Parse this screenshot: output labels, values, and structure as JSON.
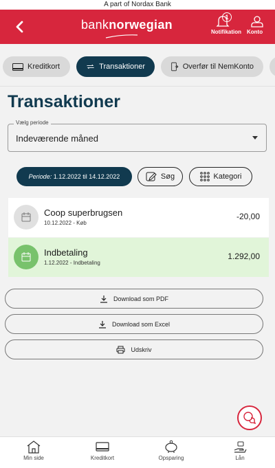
{
  "topbar": {
    "text": "A part of Nordax Bank"
  },
  "header": {
    "logo_light": "bank",
    "logo_bold": "norwegian",
    "notification_label": "Notifikation",
    "notification_count": "1",
    "account_label": "Konto",
    "brand_color": "#d7263d"
  },
  "tabs": [
    {
      "label": "Kreditkort",
      "icon": "credit-card-icon",
      "active": false
    },
    {
      "label": "Transaktioner",
      "icon": "transfer-arrows-icon",
      "active": true
    },
    {
      "label": "Overfør til NemKonto",
      "icon": "transfer-phone-icon",
      "active": false
    }
  ],
  "page": {
    "title": "Transaktioner"
  },
  "period_select": {
    "legend": "Vælg periode",
    "value": "Indeværende måned"
  },
  "filters": {
    "period_prefix": "Periode:",
    "period_range": "1.12.2022 til 14.12.2022",
    "search_label": "Søg",
    "category_label": "Kategori"
  },
  "transactions": [
    {
      "name": "Coop superbrugsen",
      "date": "10.12.2022",
      "type": "Køb",
      "amount": "-20,00"
    },
    {
      "name": "Indbetaling",
      "date": "1.12.2022",
      "type": "Indbetaling",
      "amount": "1.292,00"
    }
  ],
  "actions": {
    "pdf_label": "Download som PDF",
    "excel_label": "Download som Excel",
    "print_label": "Udskriv"
  },
  "bottom_nav": [
    {
      "label": "Min side",
      "icon": "home-icon"
    },
    {
      "label": "Kreditkort",
      "icon": "credit-card-icon"
    },
    {
      "label": "Opsparing",
      "icon": "piggy-bank-icon"
    },
    {
      "label": "Lån",
      "icon": "loan-hand-icon"
    }
  ],
  "colors": {
    "accent": "#113a4f",
    "positive_bg": "#e1f5d9",
    "positive_icon": "#78c26c"
  }
}
